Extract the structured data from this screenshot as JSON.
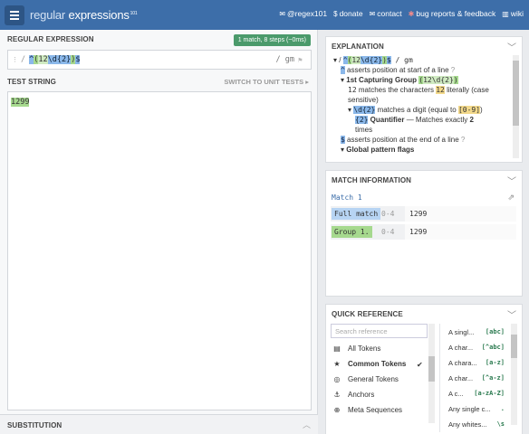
{
  "topbar": {
    "logo_main": "regular",
    "logo_second": " expressions",
    "logo_sup": "101",
    "links": [
      {
        "icon": "twitter-icon",
        "glyph": "✉",
        "label": "@regex101"
      },
      {
        "icon": "dollar-icon",
        "glyph": "$",
        "label": "donate"
      },
      {
        "icon": "mail-icon",
        "glyph": "✉",
        "label": "contact"
      },
      {
        "icon": "bug-icon",
        "glyph": "✱",
        "label": "bug reports & feedback"
      },
      {
        "icon": "library-icon",
        "glyph": "▥",
        "label": "wiki"
      }
    ]
  },
  "regex": {
    "header": "REGULAR EXPRESSION",
    "badge": "1 match, 8 steps (~0ms)",
    "delimiter": "/",
    "tokens": [
      "^",
      "(",
      "12",
      "\\d",
      "{2}",
      ")",
      "$"
    ],
    "flags": "/ gm"
  },
  "test_string": {
    "header": "TEST STRING",
    "unit_tests": "SWITCH TO UNIT TESTS ▸",
    "text": "1299"
  },
  "substitution": {
    "header": "SUBSTITUTION"
  },
  "explanation": {
    "header": "EXPLANATION",
    "lines": {
      "root_prefix": "▾ / ",
      "root_tokens": [
        "^",
        "(",
        "12",
        "\\d",
        "{2}",
        ")",
        "$"
      ],
      "root_suffix": " / gm",
      "caret_tok": "^",
      "caret_text": " asserts position at start of a line ",
      "group_prefix": "▾ ",
      "group_title": "1st Capturing Group",
      "group_tok_open": "(",
      "group_tok_body": "12\\d{2}",
      "group_tok_close": ")",
      "lit_code": "12",
      "lit_pre": " matches the characters ",
      "lit_tok": "12",
      "lit_post": " literally (case sensitive)",
      "d_prefix": "▾ ",
      "d_tok": "\\d{2}",
      "d_text": " matches a digit (equal to ",
      "d_range": "[0-9]",
      "d_close": ")",
      "q_tok": "{2}",
      "q_title": " Quantifier",
      "q_text": " — Matches exactly ",
      "q_num": "2",
      "q_times": "times",
      "dollar_tok": "$",
      "dollar_text": " asserts position at the end of a line ",
      "global_title": "▾ Global pattern flags",
      "help_glyph": "?"
    }
  },
  "match_info": {
    "header": "MATCH INFORMATION",
    "title": "Match 1",
    "rows": [
      {
        "label": "Full match",
        "range": "0-4",
        "value": "1299"
      },
      {
        "label": "Group 1.",
        "range": "0-4",
        "value": "1299"
      }
    ]
  },
  "quick_ref": {
    "header": "QUICK REFERENCE",
    "search_placeholder": "Search reference",
    "categories": [
      {
        "icon": "database-icon",
        "glyph": "▤",
        "label": "All Tokens"
      },
      {
        "icon": "star-icon",
        "glyph": "★",
        "label": "Common Tokens"
      },
      {
        "icon": "target-icon",
        "glyph": "◎",
        "label": "General Tokens"
      },
      {
        "icon": "anchor-icon",
        "glyph": "⚓",
        "label": "Anchors"
      },
      {
        "icon": "globe-icon",
        "glyph": "⊕",
        "label": "Meta Sequences"
      }
    ],
    "active_check": "✔",
    "tokens": [
      {
        "desc": "A singl...",
        "code": "[abc]"
      },
      {
        "desc": "A char...",
        "code": "[^abc]"
      },
      {
        "desc": "A chara...",
        "code": "[a-z]"
      },
      {
        "desc": "A char...",
        "code": "[^a-z]"
      },
      {
        "desc": "A c...",
        "code": "[a-zA-Z]"
      },
      {
        "desc": "Any single c...",
        "code": "."
      },
      {
        "desc": "Any whites...",
        "code": "\\s"
      }
    ]
  },
  "colors": {
    "topbar": "#3d6ea9",
    "badge": "#4b9a6b",
    "group": "#a6d98e",
    "token": "#8bb8ea",
    "literal": "#f3d98b"
  }
}
